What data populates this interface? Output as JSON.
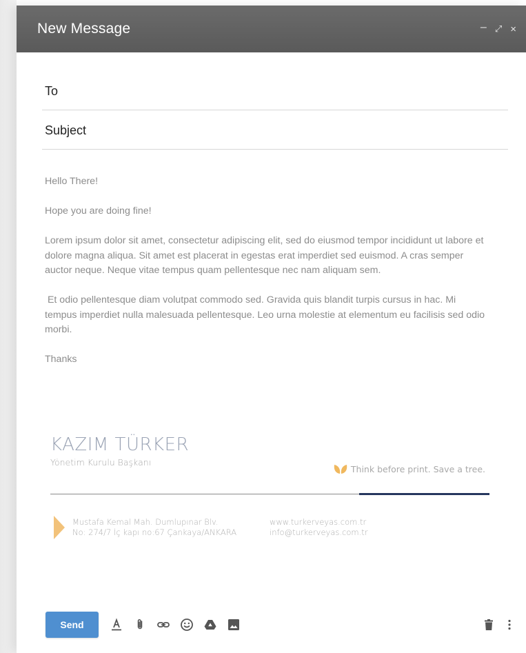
{
  "window": {
    "title": "New Message",
    "controls": {
      "minimize": "–",
      "expand": "⤢",
      "close": "×"
    }
  },
  "fields": {
    "to_label": "To",
    "to_value": "",
    "subject_label": "Subject",
    "subject_value": ""
  },
  "body": {
    "paragraphs": [
      "Hello There!",
      "Hope you are doing fine!",
      "Lorem ipsum dolor sit amet, consectetur adipiscing elit, sed do eiusmod tempor incididunt ut labore et dolore magna aliqua. Sit amet est placerat in egestas erat imperdiet sed euismod. A cras semper auctor neque. Neque vitae tempus quam pellentesque nec nam aliquam sem.",
      " Et odio pellentesque diam volutpat commodo sed. Gravida quis blandit turpis cursus in hac. Mi tempus imperdiet nulla malesuada pellentesque. Leo urna molestie at elementum eu facilisis sed odio morbi.",
      "Thanks"
    ]
  },
  "signature": {
    "name": "KAZIM TÜRKER",
    "role": "Yönetim Kurulu Başkanı",
    "eco_note": "Think before print. Save a tree.",
    "address_line1": "Mustafa Kemal Mah. Dumlupınar Blv.",
    "address_line2": "No: 274/7 İç kapı no:67 Çankaya/ANKARA",
    "website": "www.turkerveyas.com.tr",
    "email": "info@turkerveyas.com.tr",
    "accent_color": "#26375e",
    "arrow_color": "#f2c27a"
  },
  "toolbar": {
    "send_label": "Send",
    "icons": [
      "format-text-icon",
      "attach-icon",
      "link-icon",
      "emoji-icon",
      "drive-icon",
      "image-icon",
      "trash-icon",
      "more-icon"
    ]
  },
  "colors": {
    "titlebar": "#5f5f5f",
    "send_button": "#4f8fd0",
    "body_text": "#8c8c8c"
  }
}
